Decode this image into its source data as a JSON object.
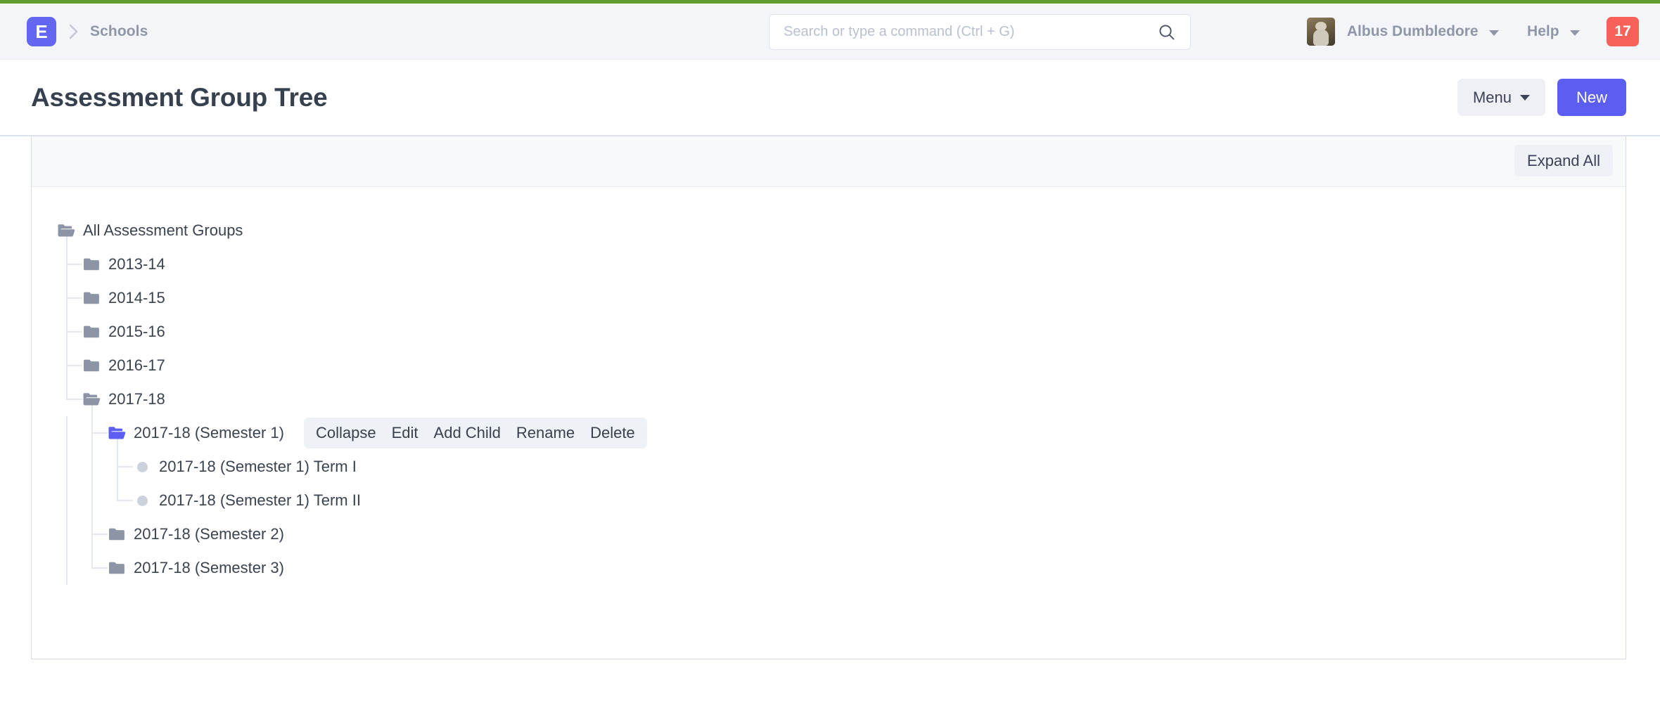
{
  "theme": {
    "accent": "#5b5ef0",
    "top_stripe": "#5f9b2d",
    "badge_bg": "#f8615a",
    "navbar_bg": "#f4f5f9",
    "folder_gray": "#8b95a6",
    "folder_active": "#5b5ef0"
  },
  "navbar": {
    "logo_letter": "E",
    "breadcrumb": "Schools",
    "breadcrumb_separator_icon": "chevron-right-icon",
    "search": {
      "placeholder": "Search or type a command (Ctrl + G)",
      "value": "",
      "icon": "search-icon"
    },
    "user": {
      "name": "Albus Dumbledore",
      "avatar_icon": "avatar",
      "caret_icon": "chevron-down-icon"
    },
    "help": {
      "label": "Help",
      "caret_icon": "chevron-down-icon"
    },
    "notifications": {
      "count": "17"
    }
  },
  "page": {
    "title": "Assessment Group Tree",
    "menu_button": "Menu",
    "menu_caret_icon": "chevron-down-icon",
    "new_button": "New"
  },
  "card": {
    "expand_all_button": "Expand All"
  },
  "node_actions": {
    "items": [
      {
        "label": "Collapse"
      },
      {
        "label": "Edit"
      },
      {
        "label": "Add Child"
      },
      {
        "label": "Rename"
      },
      {
        "label": "Delete"
      }
    ]
  },
  "tree": {
    "nodes": [
      {
        "label": "All Assessment Groups",
        "depth": 0,
        "icon": "folder-open-icon",
        "state": "expanded",
        "active": false,
        "actions": false
      },
      {
        "label": "2013-14",
        "depth": 1,
        "icon": "folder-closed-icon",
        "state": "collapsed",
        "active": false,
        "actions": false
      },
      {
        "label": "2014-15",
        "depth": 1,
        "icon": "folder-closed-icon",
        "state": "collapsed",
        "active": false,
        "actions": false
      },
      {
        "label": "2015-16",
        "depth": 1,
        "icon": "folder-closed-icon",
        "state": "collapsed",
        "active": false,
        "actions": false
      },
      {
        "label": "2016-17",
        "depth": 1,
        "icon": "folder-closed-icon",
        "state": "collapsed",
        "active": false,
        "actions": false
      },
      {
        "label": "2017-18",
        "depth": 1,
        "icon": "folder-open-icon",
        "state": "expanded",
        "active": false,
        "actions": false
      },
      {
        "label": "2017-18 (Semester 1)",
        "depth": 2,
        "icon": "folder-open-icon",
        "state": "expanded",
        "active": true,
        "actions": true
      },
      {
        "label": "2017-18 (Semester 1) Term I",
        "depth": 3,
        "icon": "leaf-dot-icon",
        "state": "leaf",
        "active": false,
        "actions": false
      },
      {
        "label": "2017-18 (Semester 1) Term II",
        "depth": 3,
        "icon": "leaf-dot-icon",
        "state": "leaf",
        "active": false,
        "actions": false
      },
      {
        "label": "2017-18 (Semester 2)",
        "depth": 2,
        "icon": "folder-closed-icon",
        "state": "collapsed",
        "active": false,
        "actions": false
      },
      {
        "label": "2017-18 (Semester 3)",
        "depth": 2,
        "icon": "folder-closed-icon",
        "state": "collapsed",
        "active": false,
        "actions": false
      }
    ]
  }
}
